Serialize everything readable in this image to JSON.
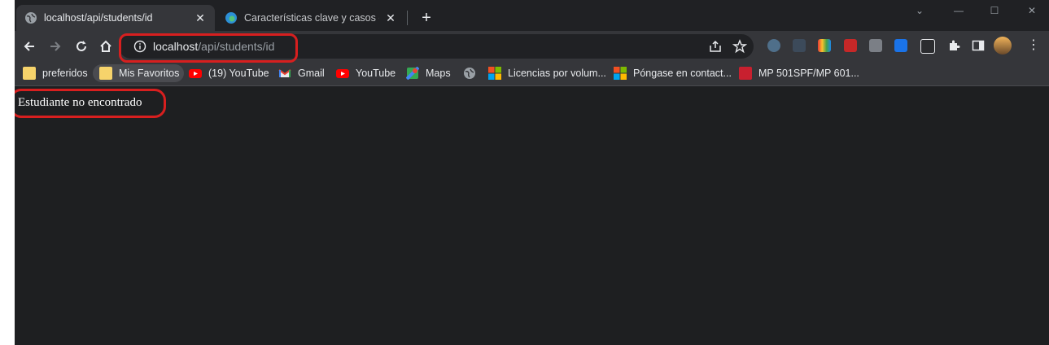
{
  "tabs": [
    {
      "title": "localhost/api/students/id",
      "active": true
    },
    {
      "title": "Características clave y casos de u",
      "active": false
    }
  ],
  "new_tab_label": "+",
  "window_controls": {
    "collapse": "⌄",
    "minimize": "—",
    "maximize": "☐",
    "close": "✕"
  },
  "address_bar": {
    "host": "localhost",
    "path": "/api/students/id"
  },
  "bookmarks": [
    {
      "label": "preferidos",
      "icon": "folder-icon"
    },
    {
      "label": "Mis Favoritos",
      "icon": "folder-icon"
    },
    {
      "label": "(19) YouTube",
      "icon": "youtube-icon"
    },
    {
      "label": "Gmail",
      "icon": "gmail-icon"
    },
    {
      "label": "YouTube",
      "icon": "youtube-icon"
    },
    {
      "label": "Maps",
      "icon": "maps-icon"
    },
    {
      "label": "",
      "icon": "globe-icon"
    },
    {
      "label": "Licencias por volum...",
      "icon": "microsoft-icon"
    },
    {
      "label": "Póngase en contact...",
      "icon": "microsoft-icon"
    },
    {
      "label": "MP 501SPF/MP 601...",
      "icon": "printer-icon"
    }
  ],
  "page": {
    "message": "Estudiante no encontrado"
  },
  "colors": {
    "annotation": "#d71f1f",
    "page_background": "#1e1f21",
    "toolbar": "#35363a"
  }
}
